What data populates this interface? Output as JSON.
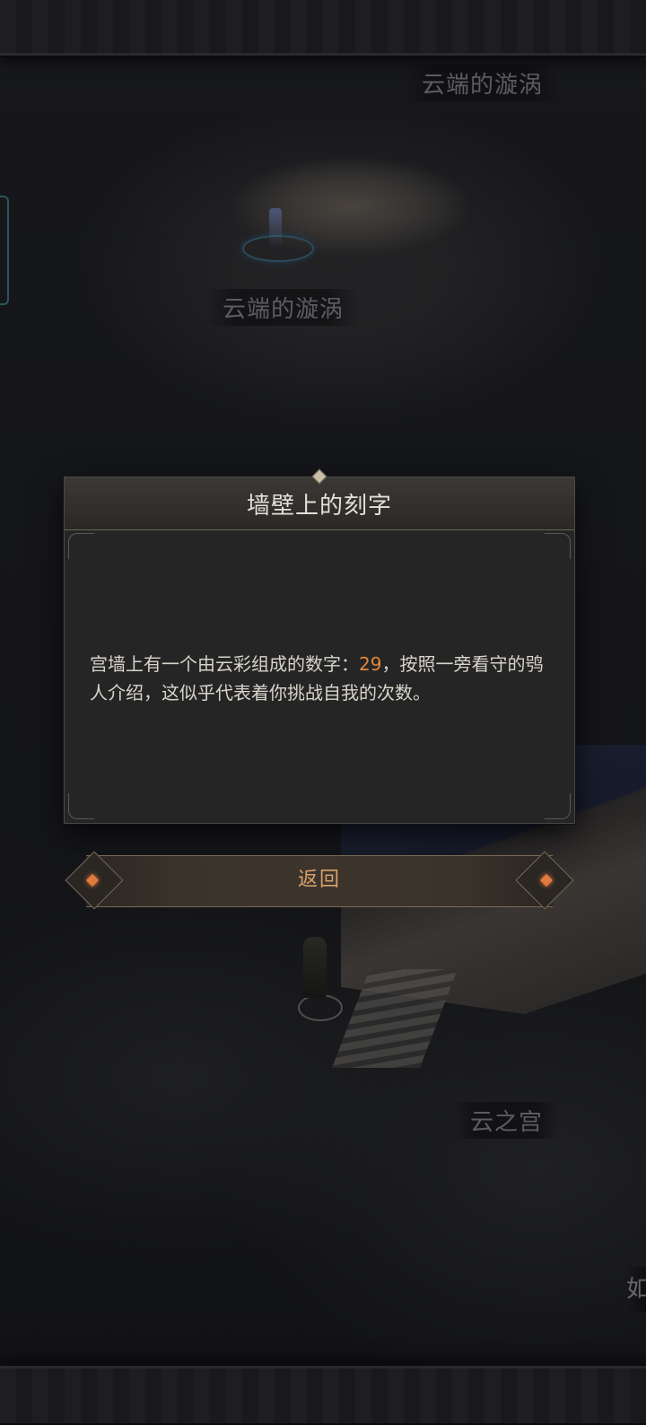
{
  "map": {
    "top_right_label": "云端的漩涡",
    "island_label": "云端的漩涡",
    "palace_label": "云之宫",
    "right_edge_glyph": "如"
  },
  "dialog": {
    "title": "墙壁上的刻字",
    "body_before": "宫墙上有一个由云彩组成的数字：",
    "highlight_number": "29",
    "body_after": "，按照一旁看守的鸮人介绍，这似乎代表着你挑战自我的次数。"
  },
  "buttons": {
    "return_label": "返回"
  },
  "colors": {
    "highlight": "#e0873a",
    "button_text": "#d9a06a",
    "portal": "#3f6f86"
  }
}
